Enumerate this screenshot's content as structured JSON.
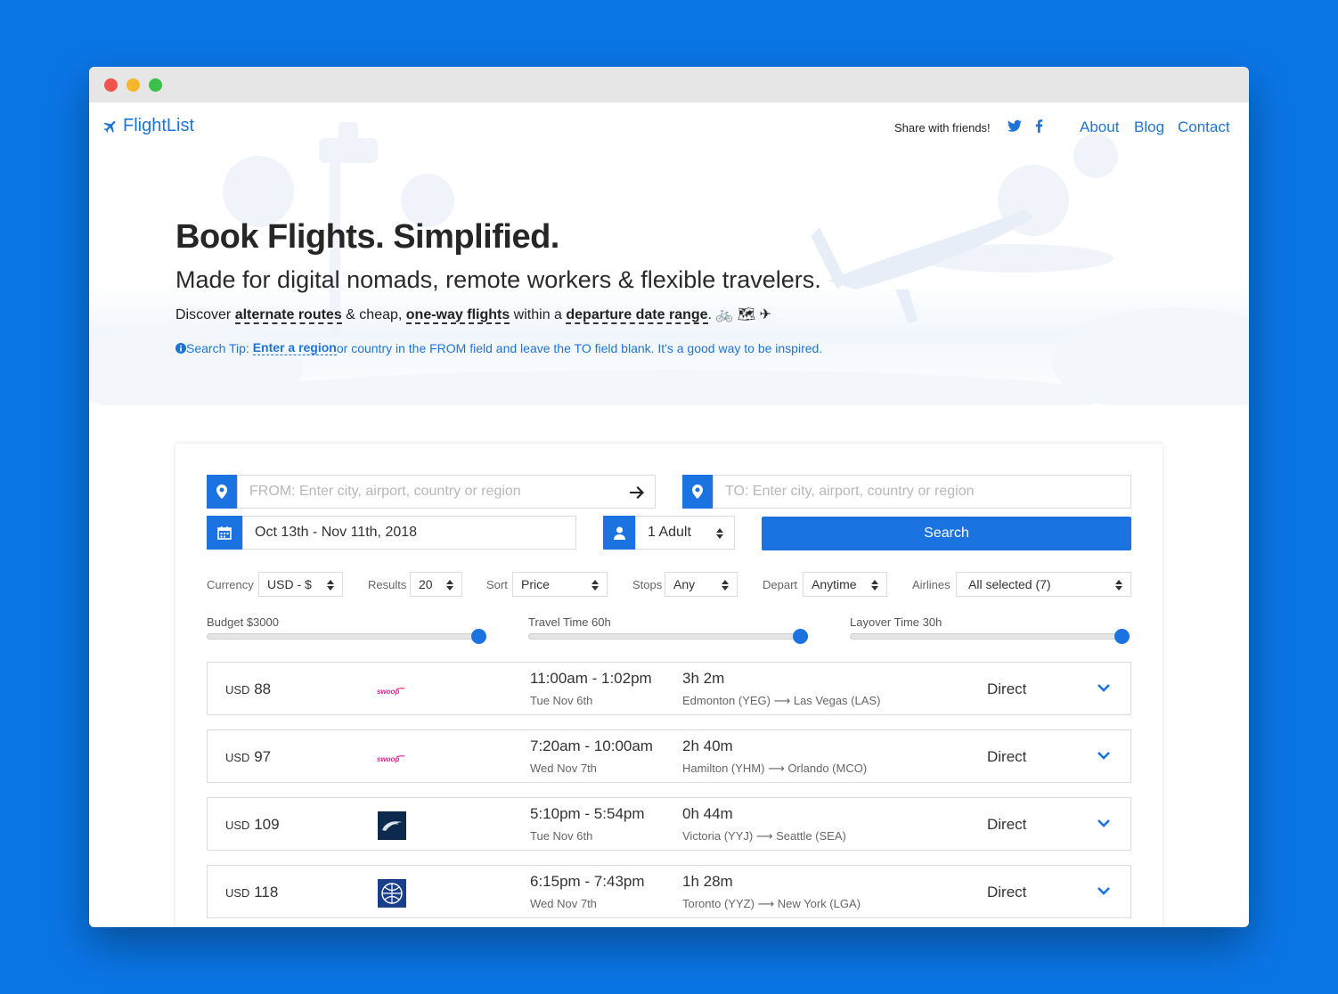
{
  "brand": {
    "name": "FlightList",
    "accent": "#1a73e0",
    "background": "#0a76e6"
  },
  "nav": {
    "share_text": "Share with friends!",
    "social": [
      "twitter-icon",
      "facebook-icon"
    ],
    "links": [
      "About",
      "Blog",
      "Contact"
    ]
  },
  "hero": {
    "title": "Book Flights. Simplified.",
    "subtitle": "Made for digital nomads, remote workers & flexible travelers.",
    "discover_prefix": "Discover ",
    "discover_link1": "alternate routes",
    "discover_mid1": " & cheap, ",
    "discover_link2": "one-way flights",
    "discover_mid2": " within a ",
    "discover_link3": "departure date range",
    "discover_suffix": ". 🚲 🗺 ✈",
    "tip_prefix": " Search Tip: ",
    "tip_link": "Enter a region",
    "tip_suffix": " or country in the FROM field and leave the TO field blank. It's a good way to be inspired."
  },
  "search": {
    "from_placeholder": "FROM: Enter city, airport, country or region",
    "to_placeholder": "TO: Enter city, airport, country or region",
    "dates": "Oct 13th - Nov 11th, 2018",
    "passengers": "1 Adult",
    "button": "Search"
  },
  "filters": {
    "currency_label": "Currency",
    "currency": "USD - $",
    "results_label": "Results",
    "results": "20",
    "sort_label": "Sort",
    "sort": "Price",
    "stops_label": "Stops",
    "stops": "Any",
    "depart_label": "Depart",
    "depart": "Anytime",
    "airlines_label": "Airlines",
    "airlines": "All selected (7)"
  },
  "sliders": {
    "budget": {
      "label": "Budget $3000",
      "fraction": 1.0
    },
    "travel": {
      "label": "Travel Time 60h",
      "fraction": 1.0
    },
    "layover": {
      "label": "Layover Time 30h",
      "fraction": 1.0
    }
  },
  "results": [
    {
      "currency": "USD",
      "price": "88",
      "airline_logo": "swoop-logo",
      "times": "11:00am - 1:02pm",
      "date": "Tue Nov 6th",
      "duration": "3h 2m",
      "route": "Edmonton (YEG) ⟶ Las Vegas (LAS)",
      "stops": "Direct"
    },
    {
      "currency": "USD",
      "price": "97",
      "airline_logo": "swoop-logo",
      "times": "7:20am - 10:00am",
      "date": "Wed Nov 7th",
      "duration": "2h 40m",
      "route": "Hamilton (YHM) ⟶ Orlando (MCO)",
      "stops": "Direct"
    },
    {
      "currency": "USD",
      "price": "109",
      "airline_logo": "alaska-logo",
      "times": "5:10pm - 5:54pm",
      "date": "Tue Nov 6th",
      "duration": "0h 44m",
      "route": "Victoria (YYJ) ⟶ Seattle (SEA)",
      "stops": "Direct"
    },
    {
      "currency": "USD",
      "price": "118",
      "airline_logo": "united-logo",
      "times": "6:15pm - 7:43pm",
      "date": "Wed Nov 7th",
      "duration": "1h 28m",
      "route": "Toronto (YYZ) ⟶ New York (LGA)",
      "stops": "Direct"
    }
  ]
}
